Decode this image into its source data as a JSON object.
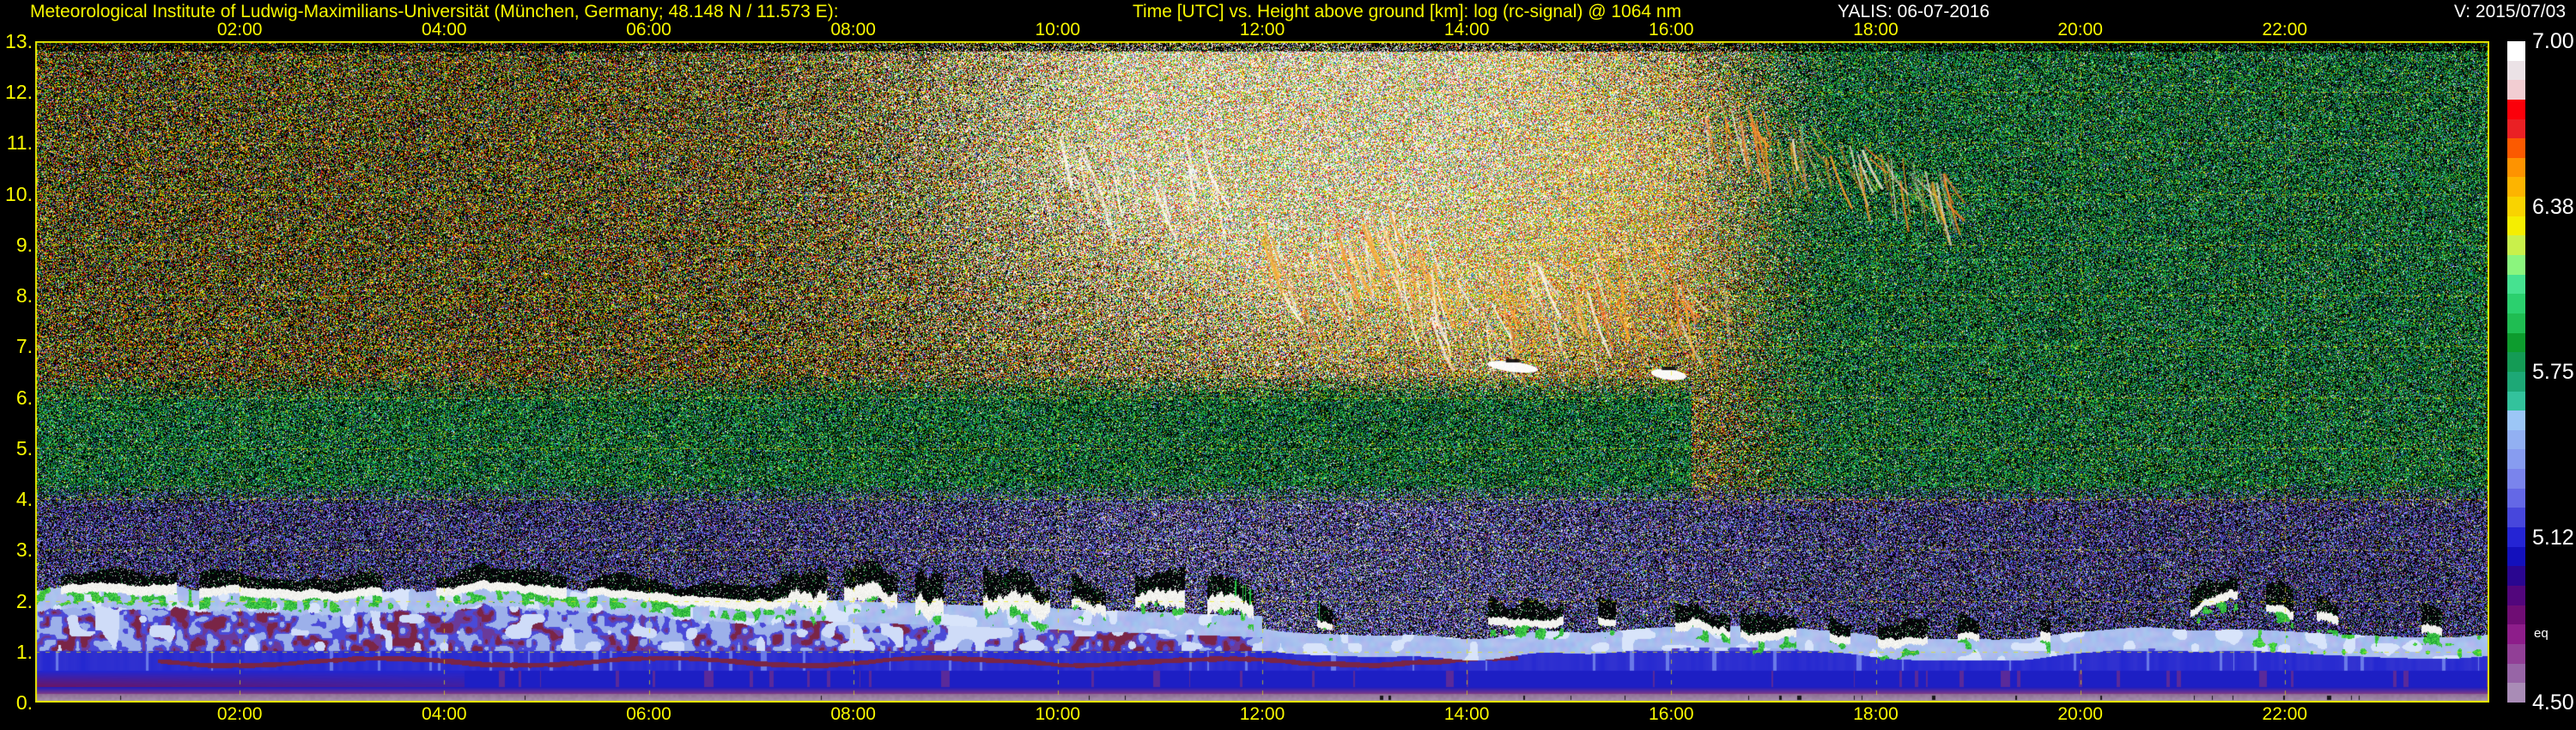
{
  "header": {
    "institute": "Meteorological Institute of Ludwig-Maximilians-Universität (München, Germany; 48.148 N / 11.573 E):",
    "plot_title": "Time [UTC] vs. Height above ground [km]: log (rc-signal) @ 1064 nm",
    "system_date": "YALIS: 06-07-2016",
    "version": "V: 2015/07/03"
  },
  "colors": {
    "background": "#000000",
    "axis_text": "#f8f800",
    "header_white": "#ffffff",
    "grid": "#ebeb00",
    "plot_border": "#e9e900"
  },
  "chart_data": {
    "type": "heatmap",
    "title": "log (rc-signal) @ 1064 nm",
    "x_axis": {
      "label": "Time [UTC]",
      "range_hours": [
        0,
        24
      ],
      "tick_hours": [
        2,
        4,
        6,
        8,
        10,
        12,
        14,
        16,
        18,
        20,
        22
      ],
      "tick_labels": [
        "02:00",
        "04:00",
        "06:00",
        "08:00",
        "10:00",
        "12:00",
        "14:00",
        "16:00",
        "18:00",
        "20:00",
        "22:00"
      ]
    },
    "y_axis": {
      "label": "Height above ground [km]",
      "range_km": [
        0,
        13
      ],
      "tick_values": [
        13,
        12,
        11,
        10,
        9,
        8,
        7,
        6,
        5,
        4,
        3,
        2,
        1,
        0
      ],
      "tick_labels": [
        "13.",
        "12.",
        "11.",
        "10.",
        "9.",
        "8.",
        "7.",
        "6.",
        "5.",
        "4.",
        "3.",
        "2.",
        "1.",
        "0."
      ]
    },
    "colorbar": {
      "value_range": [
        4.5,
        7.0
      ],
      "tick_labels": [
        "7.00",
        "6.38",
        "5.75",
        "5.12",
        "4.50"
      ],
      "tick_fractions": [
        0,
        0.25,
        0.5,
        0.75,
        1
      ],
      "footnote": "eq",
      "stops": [
        "#ffffff",
        "#ebe2e6",
        "#f2cdd2",
        "#fb000a",
        "#ea2024",
        "#fb5a00",
        "#fe9300",
        "#fdb400",
        "#f9d300",
        "#f5ee00",
        "#c9f04b",
        "#8bf57e",
        "#46e290",
        "#2bd06e",
        "#1fbd52",
        "#0d9c2e",
        "#149b55",
        "#1da876",
        "#33c29c",
        "#9cc6f6",
        "#92b0f2",
        "#879cf0",
        "#7a84ec",
        "#6468e6",
        "#4747dc",
        "#2424d4",
        "#1310bc",
        "#2a0690",
        "#52067c",
        "#6f0d74",
        "#8d1d8a",
        "#913f96",
        "#9765a6",
        "#a98cb6"
      ]
    },
    "grid": {
      "h_km": [
        1,
        2,
        3,
        4,
        5,
        6,
        7,
        8,
        9,
        10,
        11,
        12
      ],
      "v_hours": [
        2,
        4,
        6,
        8,
        10,
        12,
        14,
        16,
        18,
        20,
        22
      ],
      "dash": [
        5,
        7
      ]
    },
    "palette": {
      "speckle": {
        "red": "#e82010",
        "yellow": "#e8d800",
        "green": "#30b830",
        "orange": "#f07818",
        "blue": "#4858e0",
        "white": "#f2f2f2",
        "cyan": "#28b8a0",
        "magenta": "#b03068",
        "teal": "#109a64",
        "dark_green": "#0b7a2c",
        "lavender": "#8e8ef0",
        "violet": "#7030c8",
        "maroon": "#8c2a50",
        "pink": "#f0e4de",
        "brown": "#543416"
      },
      "boundary_layer": {
        "haze": "#a2b6ee",
        "wisp": "#d8e4fa",
        "deep_blue": "#2226d0",
        "maroon": "#7a2546",
        "violet": "#6a3a9a",
        "magenta": "#6e1560",
        "purple": "#7c3a88",
        "mauve_top": "#8d6a96",
        "mauve_bottom": "#ab9cae",
        "cloud_white": "#f6f6f4",
        "cloud_cap": "#050508",
        "green_patch": "#1eb848"
      }
    },
    "features": [
      {
        "name": "background-noise-night",
        "time_h": [
          0,
          24
        ],
        "height_km": [
          2.6,
          13
        ],
        "tone": "multicolour"
      },
      {
        "name": "daylight-background-brightening",
        "time_h": [
          7.5,
          16.5
        ],
        "height_km": [
          5,
          13
        ],
        "peak_time_h": 12.6
      },
      {
        "name": "warm-brown-day-tint",
        "time_h": [
          12,
          17.2
        ],
        "height_km": [
          6,
          12.5
        ]
      },
      {
        "name": "evening-teal-noise",
        "time_h": [
          16.5,
          24
        ],
        "height_km": [
          4.2,
          13
        ]
      },
      {
        "name": "mid-level-teal-noise",
        "time_h": [
          0,
          16.2
        ],
        "height_km": [
          4.25,
          6.4
        ]
      },
      {
        "name": "low-level-purple-blue-noise",
        "time_h": [
          0,
          24
        ],
        "height_km": [
          2.5,
          4.25
        ]
      },
      {
        "name": "cirrus-streaks-1",
        "time_h": [
          9.8,
          11.6
        ],
        "height_km": [
          9.0,
          11.2
        ],
        "tone": "white",
        "density": 22
      },
      {
        "name": "cirrus-streaks-2",
        "time_h": [
          12.0,
          13.6
        ],
        "height_km": [
          6.3,
          9.8
        ],
        "tone": "mixed",
        "density": 42
      },
      {
        "name": "cirrus-streaks-3",
        "time_h": [
          13.6,
          15.2
        ],
        "height_km": [
          5.9,
          8.8
        ],
        "tone": "mixed",
        "density": 36
      },
      {
        "name": "cirrus-streaks-4",
        "time_h": [
          15.2,
          16.6
        ],
        "height_km": [
          6.0,
          9.2
        ],
        "tone": "orange",
        "density": 20
      },
      {
        "name": "cirrus-streaks-5",
        "time_h": [
          16.3,
          18.7
        ],
        "height_km": [
          9.6,
          12.1
        ],
        "tone": "orange",
        "density": 34
      },
      {
        "name": "cloud-blob-1",
        "time_h": [
          14.2,
          14.7
        ],
        "height_km": [
          6.4,
          6.8
        ],
        "tone": "white"
      },
      {
        "name": "cloud-blob-2",
        "time_h": [
          15.8,
          16.15
        ],
        "height_km": [
          6.3,
          6.6
        ],
        "tone": "white"
      },
      {
        "name": "boundary-layer-cloud-band",
        "time_h": [
          0,
          7.3
        ],
        "height_km": [
          2.1,
          2.45
        ]
      },
      {
        "name": "boundary-layer-spiky-clouds",
        "time_h": [
          7.3,
          12
        ],
        "height_km": [
          1.6,
          2.6
        ]
      },
      {
        "name": "broken-cloud-patches",
        "time_h": [
          12,
          24
        ],
        "height_km": [
          1.2,
          2.1
        ],
        "coverage": 0.42
      },
      {
        "name": "aerosol-haze-layer",
        "time_h": [
          0,
          24
        ],
        "height_km": [
          0.9,
          2.2
        ]
      },
      {
        "name": "deep-blue-layer",
        "time_h": [
          0,
          24
        ],
        "height_km": [
          0.3,
          0.95
        ]
      },
      {
        "name": "overlap-zone-mauve",
        "time_h": [
          0,
          24
        ],
        "height_km": [
          0,
          0.25
        ]
      }
    ]
  }
}
